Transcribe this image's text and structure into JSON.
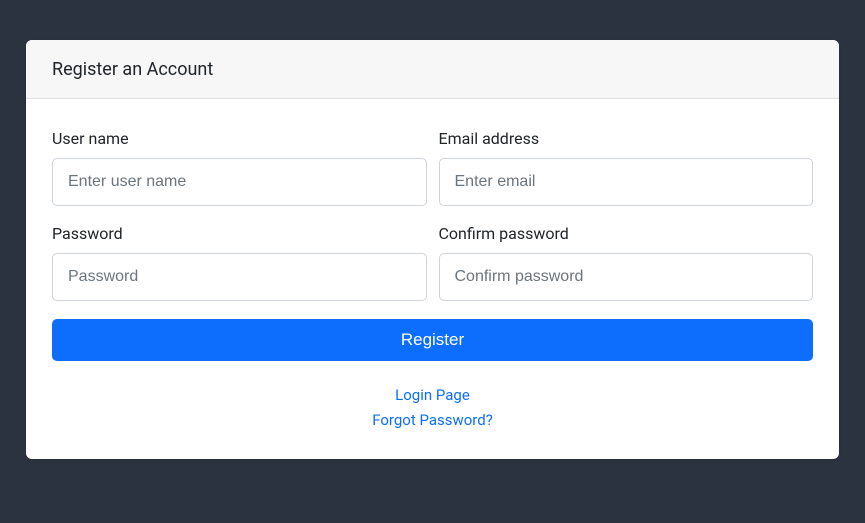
{
  "header": {
    "title": "Register an Account"
  },
  "form": {
    "username": {
      "label": "User name",
      "placeholder": "Enter user name",
      "value": ""
    },
    "email": {
      "label": "Email address",
      "placeholder": "Enter email",
      "value": ""
    },
    "password": {
      "label": "Password",
      "placeholder": "Password",
      "value": ""
    },
    "confirm_password": {
      "label": "Confirm password",
      "placeholder": "Confirm password",
      "value": ""
    },
    "submit_label": "Register"
  },
  "links": {
    "login": "Login Page",
    "forgot": "Forgot Password?"
  }
}
